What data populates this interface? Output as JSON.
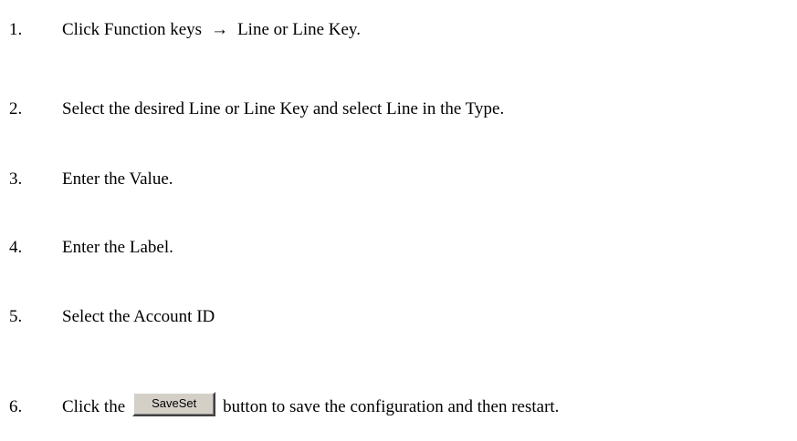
{
  "steps": [
    {
      "number": "1.",
      "before": "Click Function keys",
      "arrow": "→",
      "after": "Line or Line Key."
    },
    {
      "number": "2.",
      "text": "Select the desired Line or Line Key and select Line in the Type."
    },
    {
      "number": "3.",
      "text": "Enter the Value."
    },
    {
      "number": "4.",
      "text": "Enter the Label."
    },
    {
      "number": "5.",
      "text": "Select the Account ID"
    },
    {
      "number": "6.",
      "before": "Click the",
      "button_label": "SaveSet",
      "after": "button to save the configuration and then restart."
    }
  ],
  "colors": {
    "background": "#ffffff",
    "text": "#000000",
    "button_face": "#d4d0c8"
  }
}
